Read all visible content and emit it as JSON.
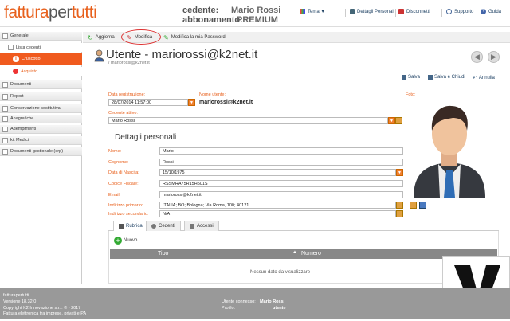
{
  "header": {
    "logo": {
      "part1": "fattura",
      "part2": "per",
      "part3": "tutti"
    },
    "cedente_label": "cedente:",
    "cedente_value": "Mario Rossi",
    "abbonamento_label": "abbonamento:",
    "abbonamento_value": "PREMIUM",
    "links": {
      "tema": "Tema",
      "dettagli": "Dettagli Personali",
      "disconnetti": "Disconnetti",
      "supporto": "Supporto",
      "guida": "Guida"
    }
  },
  "sidebar": {
    "generale": "Generale",
    "lista_cedenti": "Lista cedenti",
    "cruscotto": "Cruscotto",
    "acquisto": "Acquisto",
    "documenti": "Documenti",
    "report": "Report",
    "conservazione": "Conservazione sostitutiva",
    "anagrafiche": "Anagrafiche",
    "adempimenti": "Adempimenti",
    "kit_medici": "kit Medici",
    "documenti_gestionale": "Documenti gestionale (erp)"
  },
  "toolbar": {
    "aggiorna": "Aggiorna",
    "modifica": "Modifica",
    "modifica_password": "Modifica la mia Password"
  },
  "page": {
    "title": "Utente - mariorossi@k2net.it",
    "subtitle": "/ mariorossi@k2net.it",
    "actions": {
      "salva": "Salva",
      "salva_chiudi": "Salva e Chiudi",
      "annulla": "Annulla"
    }
  },
  "form": {
    "data_registrazione_label": "Data registrazione:",
    "data_registrazione": "28/07/2014 11:57:00",
    "nome_utente_label": "Nome utente:",
    "nome_utente": "mariorossi@k2net.it",
    "foto_label": "Foto:",
    "cedente_attivo_label": "Cedente attivo:",
    "cedente_attivo": "Mario Rossi",
    "section_title": "Dettagli personali",
    "nome_label": "Nome:",
    "nome": "Mario",
    "cognome_label": "Cognome:",
    "cognome": "Rossi",
    "nascita_label": "Data di Nascita:",
    "nascita": "15/10/1975",
    "cf_label": "Codice Fiscale:",
    "cf": "RSSMRA75R15H501S",
    "email_label": "Email:",
    "email": "mariorossi@k2net.it",
    "ind_primario_label": "Indirizzo primario:",
    "ind_primario": "ITALIA; BO; Bologna; Via Roma, 100; 40121",
    "ind_secondario_label": "Indirizzo secondario:",
    "ind_secondario": "N/A"
  },
  "tabs": {
    "rubrica": "Rubrica",
    "cedenti": "Cedenti",
    "accessi": "Accessi"
  },
  "grid": {
    "nuovo": "Nuovo",
    "col_tipo": "Tipo",
    "col_numero": "Numero",
    "empty": "Nessun dato da visualizzare"
  },
  "footer": {
    "line1": "fatturapertutti",
    "line2": "Versione 18.32.0",
    "line3": "Copyright K2 Innovazione s.r.l. © - 2017",
    "line4": "Fattura elettronica tra imprese, privati e PA",
    "connesso_label": "Utente connesso:",
    "connesso": "Mario Rossi",
    "profilo_label": "Profilo:",
    "profilo": "utente"
  },
  "colors": {
    "accent": "#f05a1e",
    "link": "#224466"
  }
}
